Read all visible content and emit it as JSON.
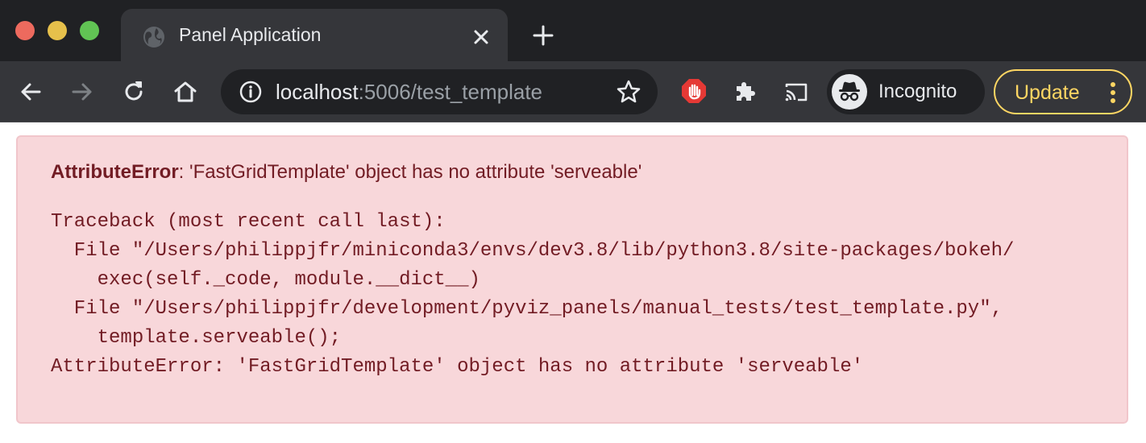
{
  "window": {
    "traffic_lights": {
      "close": "#ed6a5e",
      "minimize": "#e6c04b",
      "maximize": "#61c454"
    }
  },
  "tab": {
    "title": "Panel Application",
    "favicon": "globe-icon"
  },
  "toolbar": {
    "url_host": "localhost",
    "url_rest": ":5006/test_template",
    "incognito_label": "Incognito",
    "update_label": "Update",
    "extensions": [
      "adblock-icon",
      "puzzle-icon",
      "cast-icon"
    ]
  },
  "error": {
    "type": "AttributeError",
    "message": ": 'FastGridTemplate' object has no attribute 'serveable'",
    "traceback_lines": [
      "Traceback (most recent call last):",
      "  File \"/Users/philippjfr/miniconda3/envs/dev3.8/lib/python3.8/site-packages/bokeh/",
      "    exec(self._code, module.__dict__)",
      "  File \"/Users/philippjfr/development/pyviz_panels/manual_tests/test_template.py\",",
      "    template.serveable();",
      "AttributeError: 'FastGridTemplate' object has no attribute 'serveable'"
    ]
  },
  "colors": {
    "chrome_dark": "#202124",
    "chrome_toolbar": "#35363a",
    "update_accent": "#fdd663",
    "alert_bg": "#f8d7da",
    "alert_text": "#721c24"
  }
}
